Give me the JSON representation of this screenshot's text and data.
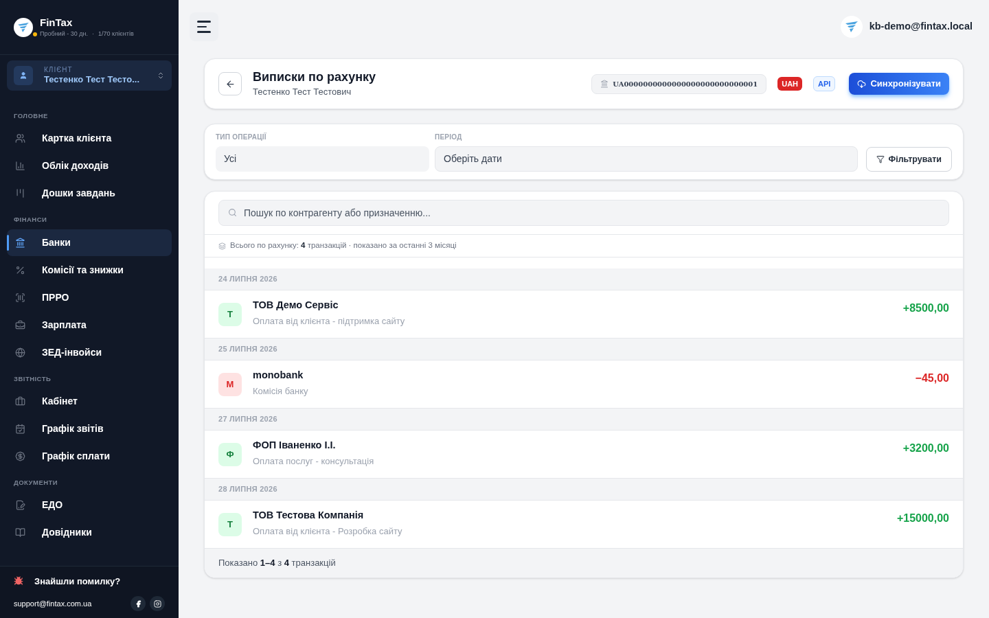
{
  "brand": {
    "name": "FinTax",
    "plan": "Пробний - 30 дн.",
    "separator": "·",
    "clients": "1/70 клієнтів"
  },
  "client": {
    "label": "КЛІЄНТ",
    "name": "Тестенко Тест Тесто..."
  },
  "nav": [
    {
      "title": "ГОЛОВНЕ",
      "items": [
        {
          "label": "Картка клієнта",
          "selected": false
        },
        {
          "label": "Облік доходів",
          "selected": false
        },
        {
          "label": "Дошки завдань",
          "selected": false
        }
      ]
    },
    {
      "title": "ФІНАНСИ",
      "items": [
        {
          "label": "Банки",
          "selected": true
        },
        {
          "label": "Комісії та знижки",
          "selected": false
        },
        {
          "label": "ПРРО",
          "selected": false
        },
        {
          "label": "Зарплата",
          "selected": false
        },
        {
          "label": "ЗЕД-інвойси",
          "selected": false
        }
      ]
    },
    {
      "title": "ЗВІТНІСТЬ",
      "items": [
        {
          "label": "Кабінет",
          "selected": false
        },
        {
          "label": "Графік звітів",
          "selected": false
        },
        {
          "label": "Графік сплати",
          "selected": false
        }
      ]
    },
    {
      "title": "ДОКУМЕНТИ",
      "items": [
        {
          "label": "ЕДО",
          "selected": false
        },
        {
          "label": "Довідники",
          "selected": false
        }
      ]
    }
  ],
  "footer": {
    "bug": "Знайшли помилку?",
    "email": "support@fintax.com.ua"
  },
  "user": {
    "email": "kb-demo@fintax.local"
  },
  "header": {
    "title": "Виписки по рахунку",
    "subtitle": "Тестенко Тест Тестович",
    "iban": "UA0000000000000000000000000001",
    "currency": "UAH",
    "source": "API",
    "sync": "Синхронізувати"
  },
  "filters": {
    "type_label": "ТИП ОПЕРАЦІЇ",
    "type_value": "Усі",
    "period_label": "ПЕРІОД",
    "period_value": "Оберіть дати",
    "apply": "Фільтрувати"
  },
  "search": {
    "placeholder": "Пошук по контрагенту або призначенню..."
  },
  "summary": "Всього по рахунку: **4** транзакцій · показано за останні 3 місяці",
  "groups": [
    {
      "date": "24 ЛИПНЯ 2026",
      "transactions": [
        {
          "initial": "Т",
          "name": "ТОВ Демо Сервіс",
          "purpose": "Оплата від клієнта - підтримка сайту",
          "amount": "+8500,00",
          "kind": "credit"
        }
      ]
    },
    {
      "date": "25 ЛИПНЯ 2026",
      "transactions": [
        {
          "initial": "M",
          "name": "monobank",
          "purpose": "Комісія банку",
          "amount": "−45,00",
          "kind": "debit"
        }
      ]
    },
    {
      "date": "27 ЛИПНЯ 2026",
      "transactions": [
        {
          "initial": "Ф",
          "name": "ФОП Іваненко І.І.",
          "purpose": "Оплата послуг - консультація",
          "amount": "+3200,00",
          "kind": "credit"
        }
      ]
    },
    {
      "date": "28 ЛИПНЯ 2026",
      "transactions": [
        {
          "initial": "Т",
          "name": "ТОВ Тестова Компанія",
          "purpose": "Оплата від клієнта - Розробка сайту",
          "amount": "+15000,00",
          "kind": "credit"
        }
      ]
    }
  ],
  "pagination": "Показано **1–4** з **4** транзакцій"
}
